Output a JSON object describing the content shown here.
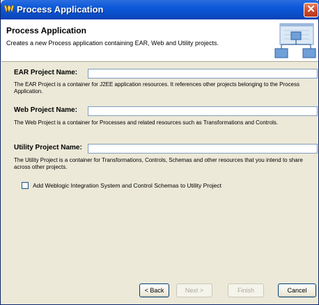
{
  "window": {
    "title": "Process Application",
    "close_glyph": "✕"
  },
  "header": {
    "title": "Process Application",
    "description": "Creates a new Process application containing EAR, Web and Utility projects.",
    "graphic_icon": "project-structure-graphic"
  },
  "form": {
    "ear": {
      "label": "EAR Project Name:",
      "value": "",
      "description": "The EAR Project is a container for J2EE application resources.  It references other projects belonging to the Process Application."
    },
    "web": {
      "label": "Web Project Name:",
      "value": "",
      "description": "The Web Project is a container for Processes and related resources such as Transformations and Controls."
    },
    "utility": {
      "label": "Utility Project Name:",
      "value": "",
      "description": "The Utility Project is a container for Transformations, Controls, Schemas and other resources that you intend to share across other projects."
    },
    "add_schemas": {
      "label": "Add Weblogic Integration System and Control Schemas to Utility Project",
      "checked": false
    }
  },
  "buttons": {
    "back": "< Back",
    "next": "Next >",
    "finish": "Finish",
    "cancel": "Cancel"
  }
}
